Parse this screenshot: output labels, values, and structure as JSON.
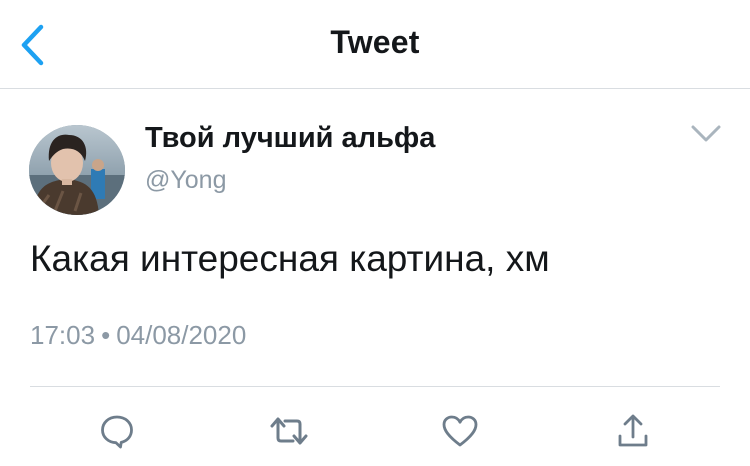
{
  "header": {
    "title": "Tweet",
    "back_icon": "chevron-left-icon",
    "accent_color": "#1da1f2"
  },
  "tweet": {
    "author": {
      "display_name": "Твой лучший альфа",
      "handle": "@Yong"
    },
    "text": "Какая интересная картина, хм",
    "time": "17:03",
    "separator": "•",
    "date": "04/08/2020"
  },
  "actions": [
    {
      "name": "reply",
      "icon": "reply-icon"
    },
    {
      "name": "retweet",
      "icon": "retweet-icon"
    },
    {
      "name": "like",
      "icon": "heart-icon"
    },
    {
      "name": "share",
      "icon": "share-icon"
    }
  ],
  "colors": {
    "text": "#14171a",
    "secondary": "#8c99a5",
    "divider": "#d9dde1"
  }
}
